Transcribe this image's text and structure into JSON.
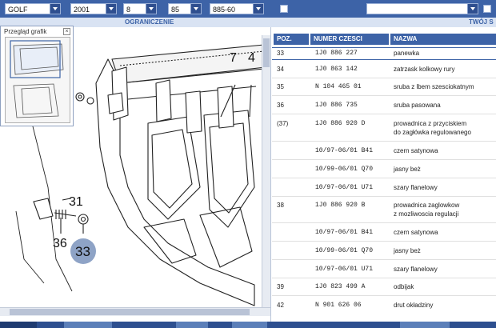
{
  "filters": {
    "model": "GOLF",
    "year": "2001",
    "field3": "8",
    "field4": "85",
    "field5": "885-60"
  },
  "subbar": {
    "label_center": "OGRANICZENIE",
    "label_right": "TWÓJ S"
  },
  "preview": {
    "title": "Przegląd grafik"
  },
  "drawing": {
    "callouts": [
      "7",
      "4",
      "31",
      "36",
      "33"
    ]
  },
  "table": {
    "headers": {
      "pos": "POZ.",
      "part": "NUMER CZESCI",
      "name": "NAZWA"
    },
    "rows": [
      {
        "pos": "33",
        "part": "1J0  886  227",
        "name": "panewka"
      },
      {
        "pos": "34",
        "part": "1J0  863  142",
        "name": "zatrzask kolkowy rury"
      },
      {
        "pos": "35",
        "part": "N    104  465  01",
        "name": "sruba  z lbem szesciokatnym"
      },
      {
        "pos": "36",
        "part": "1J0  886  735",
        "name": "sruba pasowana"
      },
      {
        "pos": "(37)",
        "part": "1J0  886  920  D",
        "name": "prowadnica z przyciskiem",
        "name2": "do zagłówka regulowanego"
      },
      {
        "pos": "",
        "part": "10/97-06/01 B41",
        "name": "czern satynowa"
      },
      {
        "pos": "",
        "part": "10/99-06/01 Q70",
        "name": "jasny beż"
      },
      {
        "pos": "",
        "part": "10/97-06/01 U71",
        "name": "szary flanelowy"
      },
      {
        "pos": "38",
        "part": "1J0  886  920  B",
        "name": "prowadnica zaglowkow",
        "name2": "z mozliwoscia regulacji"
      },
      {
        "pos": "",
        "part": "10/97-06/01 B41",
        "name": "czern satynowa"
      },
      {
        "pos": "",
        "part": "10/99-06/01 Q70",
        "name": "jasny beż"
      },
      {
        "pos": "",
        "part": "10/97-06/01 U71",
        "name": "szary flanelowy"
      },
      {
        "pos": "39",
        "part": "1J0  823  499  A",
        "name": "odbijak"
      },
      {
        "pos": "42",
        "part": "N    901  626  06",
        "name": "drut okładziny"
      }
    ]
  }
}
